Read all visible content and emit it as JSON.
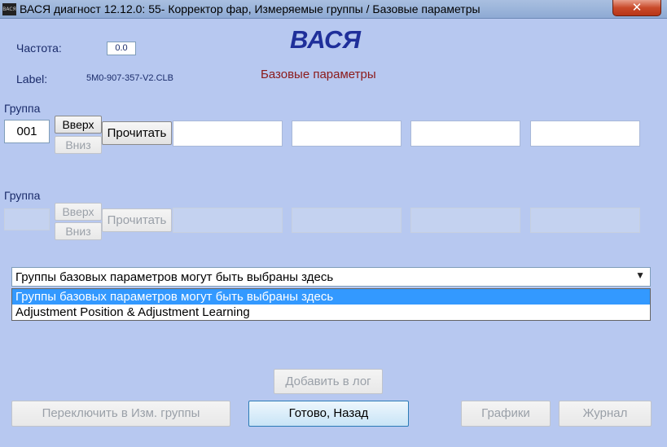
{
  "window": {
    "title": "ВАСЯ диагност 12.12.0: 55- Корректор фар,  Измеряемые группы / Базовые параметры",
    "icon_text": "ВАСЯ",
    "close_glyph": "✕"
  },
  "header": {
    "freq_label": "Частота:",
    "freq_value": "0.0",
    "label_label": "Label:",
    "label_value": "5M0-907-357-V2.CLB",
    "brand": "ВАСЯ",
    "subtitle": "Базовые параметры"
  },
  "group1": {
    "label": "Группа",
    "value": "001",
    "up": "Вверх",
    "down": "Вниз",
    "read": "Прочитать"
  },
  "group2": {
    "label": "Группа",
    "value": "",
    "up": "Вверх",
    "down": "Вниз",
    "read": "Прочитать"
  },
  "combo": {
    "selected": "Группы базовых параметров могут быть выбраны здесь",
    "arrow_glyph": "▼",
    "options": [
      "Группы базовых параметров могут быть выбраны здесь",
      "Adjustment Position & Adjustment Learning"
    ]
  },
  "buttons": {
    "add_log": "Добавить в лог",
    "switch": "Переключить в Изм. группы",
    "done": "Готово, Назад",
    "graphs": "Графики",
    "journal": "Журнал"
  }
}
